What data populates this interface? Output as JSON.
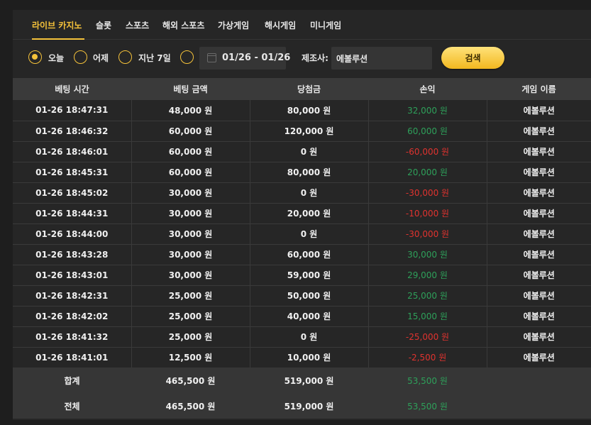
{
  "tabs": [
    {
      "label": "라이브 카지노",
      "active": true
    },
    {
      "label": "슬롯",
      "active": false
    },
    {
      "label": "스포츠",
      "active": false
    },
    {
      "label": "해외 스포츠",
      "active": false
    },
    {
      "label": "가상게임",
      "active": false
    },
    {
      "label": "해시게임",
      "active": false
    },
    {
      "label": "미니게임",
      "active": false
    }
  ],
  "filter": {
    "options": [
      {
        "label": "오늘",
        "checked": true
      },
      {
        "label": "어제",
        "checked": false
      },
      {
        "label": "지난 7일",
        "checked": false
      },
      {
        "label": "",
        "checked": false
      }
    ],
    "date_range": "01/26 - 01/26",
    "maker_label": "제조사:",
    "maker_value": "에볼루션",
    "search_label": "검색"
  },
  "table": {
    "headers": [
      "베팅 시간",
      "베팅 금액",
      "당첨금",
      "손익",
      "게임 이름"
    ],
    "rows": [
      {
        "time": "01-26 18:47:31",
        "bet": "48,000 원",
        "win": "80,000 원",
        "pl": "32,000 원",
        "game": "에볼루션",
        "sign": "pos"
      },
      {
        "time": "01-26 18:46:32",
        "bet": "60,000 원",
        "win": "120,000 원",
        "pl": "60,000 원",
        "game": "에볼루션",
        "sign": "pos"
      },
      {
        "time": "01-26 18:46:01",
        "bet": "60,000 원",
        "win": "0 원",
        "pl": "-60,000 원",
        "game": "에볼루션",
        "sign": "neg"
      },
      {
        "time": "01-26 18:45:31",
        "bet": "60,000 원",
        "win": "80,000 원",
        "pl": "20,000 원",
        "game": "에볼루션",
        "sign": "pos"
      },
      {
        "time": "01-26 18:45:02",
        "bet": "30,000 원",
        "win": "0 원",
        "pl": "-30,000 원",
        "game": "에볼루션",
        "sign": "neg"
      },
      {
        "time": "01-26 18:44:31",
        "bet": "30,000 원",
        "win": "20,000 원",
        "pl": "-10,000 원",
        "game": "에볼루션",
        "sign": "neg"
      },
      {
        "time": "01-26 18:44:00",
        "bet": "30,000 원",
        "win": "0 원",
        "pl": "-30,000 원",
        "game": "에볼루션",
        "sign": "neg"
      },
      {
        "time": "01-26 18:43:28",
        "bet": "30,000 원",
        "win": "60,000 원",
        "pl": "30,000 원",
        "game": "에볼루션",
        "sign": "pos"
      },
      {
        "time": "01-26 18:43:01",
        "bet": "30,000 원",
        "win": "59,000 원",
        "pl": "29,000 원",
        "game": "에볼루션",
        "sign": "pos"
      },
      {
        "time": "01-26 18:42:31",
        "bet": "25,000 원",
        "win": "50,000 원",
        "pl": "25,000 원",
        "game": "에볼루션",
        "sign": "pos"
      },
      {
        "time": "01-26 18:42:02",
        "bet": "25,000 원",
        "win": "40,000 원",
        "pl": "15,000 원",
        "game": "에볼루션",
        "sign": "pos"
      },
      {
        "time": "01-26 18:41:32",
        "bet": "25,000 원",
        "win": "0 원",
        "pl": "-25,000 원",
        "game": "에볼루션",
        "sign": "neg"
      },
      {
        "time": "01-26 18:41:01",
        "bet": "12,500 원",
        "win": "10,000 원",
        "pl": "-2,500 원",
        "game": "에볼루션",
        "sign": "neg"
      }
    ],
    "totals": [
      {
        "label": "합계",
        "bet": "465,500 원",
        "win": "519,000 원",
        "pl": "53,500 원"
      },
      {
        "label": "전체",
        "bet": "465,500 원",
        "win": "519,000 원",
        "pl": "53,500 원"
      }
    ]
  },
  "colors": {
    "accent": "#f5c23a",
    "positive": "#2ea05a",
    "negative": "#e0332f"
  }
}
